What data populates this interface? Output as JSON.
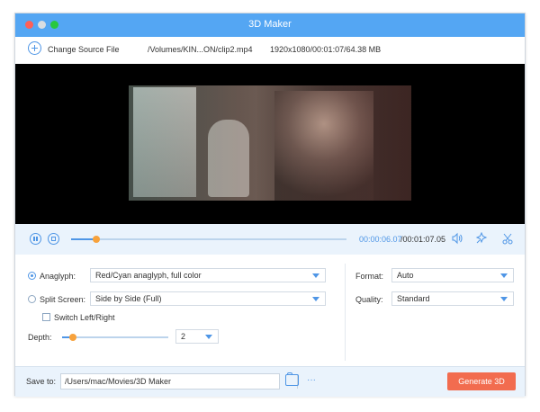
{
  "window": {
    "title": "3D Maker"
  },
  "toolbar": {
    "change_source_label": "Change Source File",
    "file_path": "/Volumes/KIN...ON/clip2.mp4",
    "file_info": "1920x1080/00:01:07/64.38 MB"
  },
  "player": {
    "current_time": "00:00:06.07",
    "total_time": "/00:01:07.05",
    "progress_fraction": 0.09,
    "icons": [
      "pause-icon",
      "stop-icon",
      "volume-icon",
      "effect-icon",
      "scissors-icon"
    ]
  },
  "settings": {
    "anaglyph_label": "Anaglyph:",
    "anaglyph_value": "Red/Cyan anaglyph, full color",
    "anaglyph_selected": true,
    "split_label": "Split Screen:",
    "split_value": "Side by Side (Full)",
    "split_selected": false,
    "switch_label": "Switch Left/Right",
    "switch_checked": false,
    "depth_label": "Depth:",
    "depth_value": "2",
    "depth_fraction": 0.1,
    "format_label": "Format:",
    "format_value": "Auto",
    "quality_label": "Quality:",
    "quality_value": "Standard"
  },
  "bottom": {
    "save_label": "Save to:",
    "save_path": "/Users/mac/Movies/3D Maker",
    "browse_label": "···",
    "generate_label": "Generate 3D"
  },
  "colors": {
    "titlebar": "#54a6f3",
    "accent": "#4f96e6",
    "thumb": "#f7a23c",
    "generate_button": "#f26c4f"
  }
}
